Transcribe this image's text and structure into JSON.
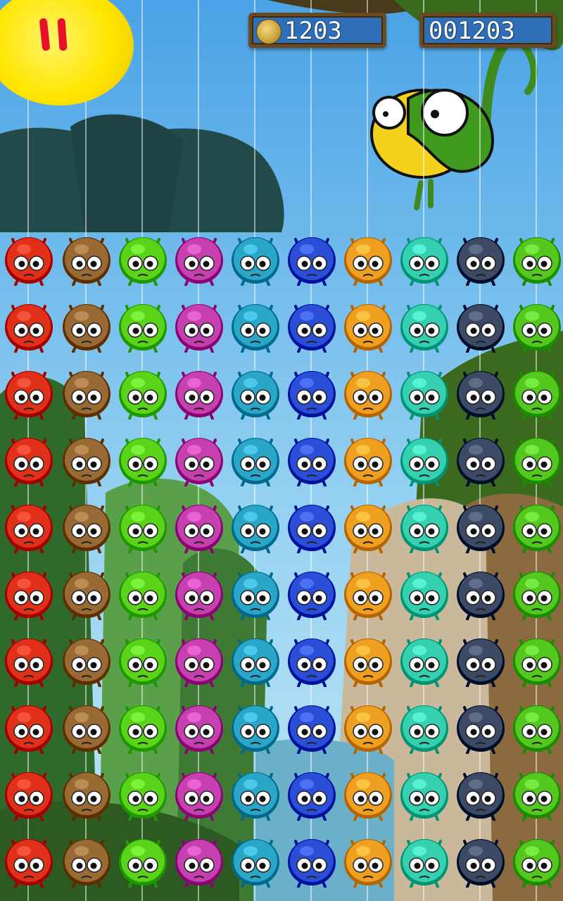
{
  "hud": {
    "coins": "1203",
    "score": "001203",
    "pause_icon": "pause-icon",
    "coin_icon": "coin-icon"
  },
  "colors": {
    "red": "#e0301a",
    "brown": "#9a6a35",
    "lime": "#5ad418",
    "magenta": "#c640b0",
    "cyan": "#2aa6c8",
    "blue": "#2a4ed8",
    "orange": "#f0a020",
    "teal": "#35d0b0",
    "navy": "#3d4a66",
    "green": "#55c820"
  },
  "board": {
    "columns": [
      "red",
      "brown",
      "lime",
      "magenta",
      "cyan",
      "blue",
      "orange",
      "teal",
      "navy",
      "green"
    ],
    "rows": 10
  }
}
